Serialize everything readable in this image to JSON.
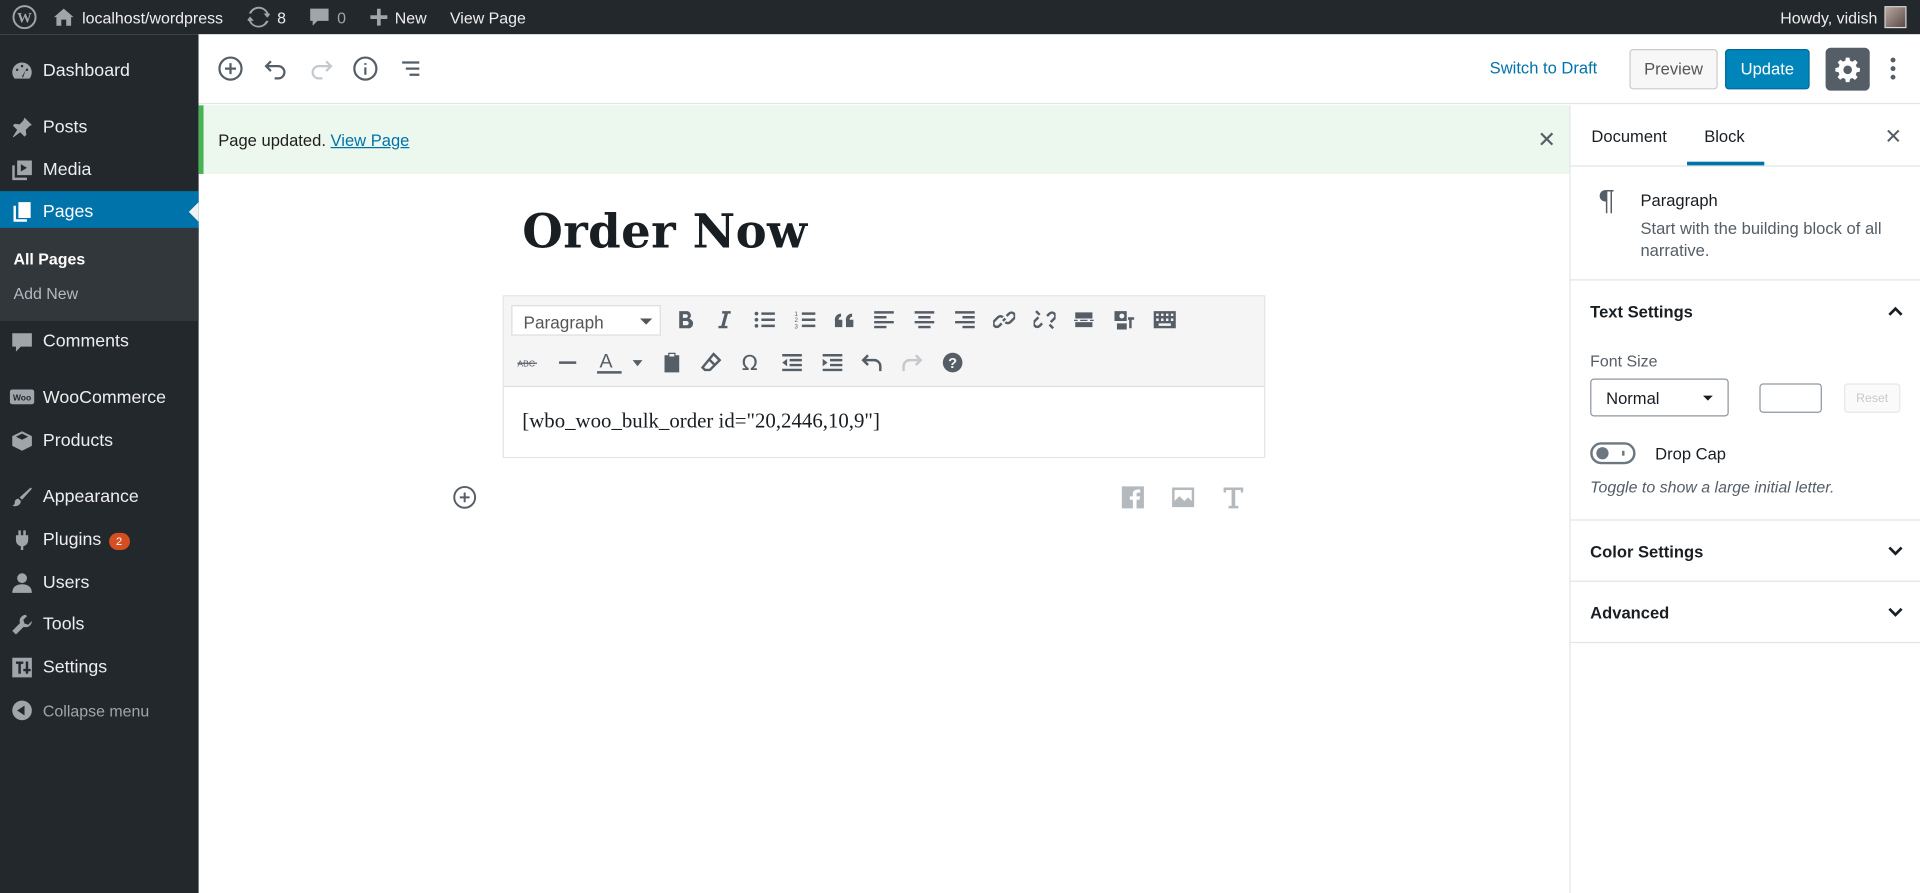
{
  "adminbar": {
    "site": "localhost/wordpress",
    "updates": "8",
    "comments": "0",
    "new": "New",
    "view_page": "View Page",
    "howdy": "Howdy, vidish"
  },
  "menu": {
    "dashboard": "Dashboard",
    "posts": "Posts",
    "media": "Media",
    "pages": "Pages",
    "all_pages": "All Pages",
    "add_new": "Add New",
    "comments": "Comments",
    "woocommerce": "WooCommerce",
    "products": "Products",
    "appearance": "Appearance",
    "plugins": "Plugins",
    "plugins_badge": "2",
    "users": "Users",
    "tools": "Tools",
    "settings": "Settings",
    "collapse": "Collapse menu"
  },
  "header": {
    "switch_to_draft": "Switch to Draft",
    "preview": "Preview",
    "update": "Update"
  },
  "notice": {
    "text": "Page updated.",
    "link": "View Page"
  },
  "content": {
    "title": "Order Now",
    "format_select": "Paragraph",
    "shortcode": "[wbo_woo_bulk_order id=\"20,2446,10,9\"]"
  },
  "sidebar": {
    "tab_document": "Document",
    "tab_block": "Block",
    "block_name": "Paragraph",
    "block_desc": "Start with the building block of all narrative.",
    "text_settings": "Text Settings",
    "font_size_label": "Font Size",
    "font_size_value": "Normal",
    "font_size_input": "",
    "reset": "Reset",
    "drop_cap": "Drop Cap",
    "drop_cap_help": "Toggle to show a large initial letter.",
    "color_settings": "Color Settings",
    "advanced": "Advanced"
  },
  "colors": {
    "admin_bg": "#23282d",
    "accent": "#0073aa",
    "update_btn": "#0085ba",
    "notice_bg": "#ecf7ed",
    "notice_border": "#46b450",
    "badge": "#d54e21"
  }
}
